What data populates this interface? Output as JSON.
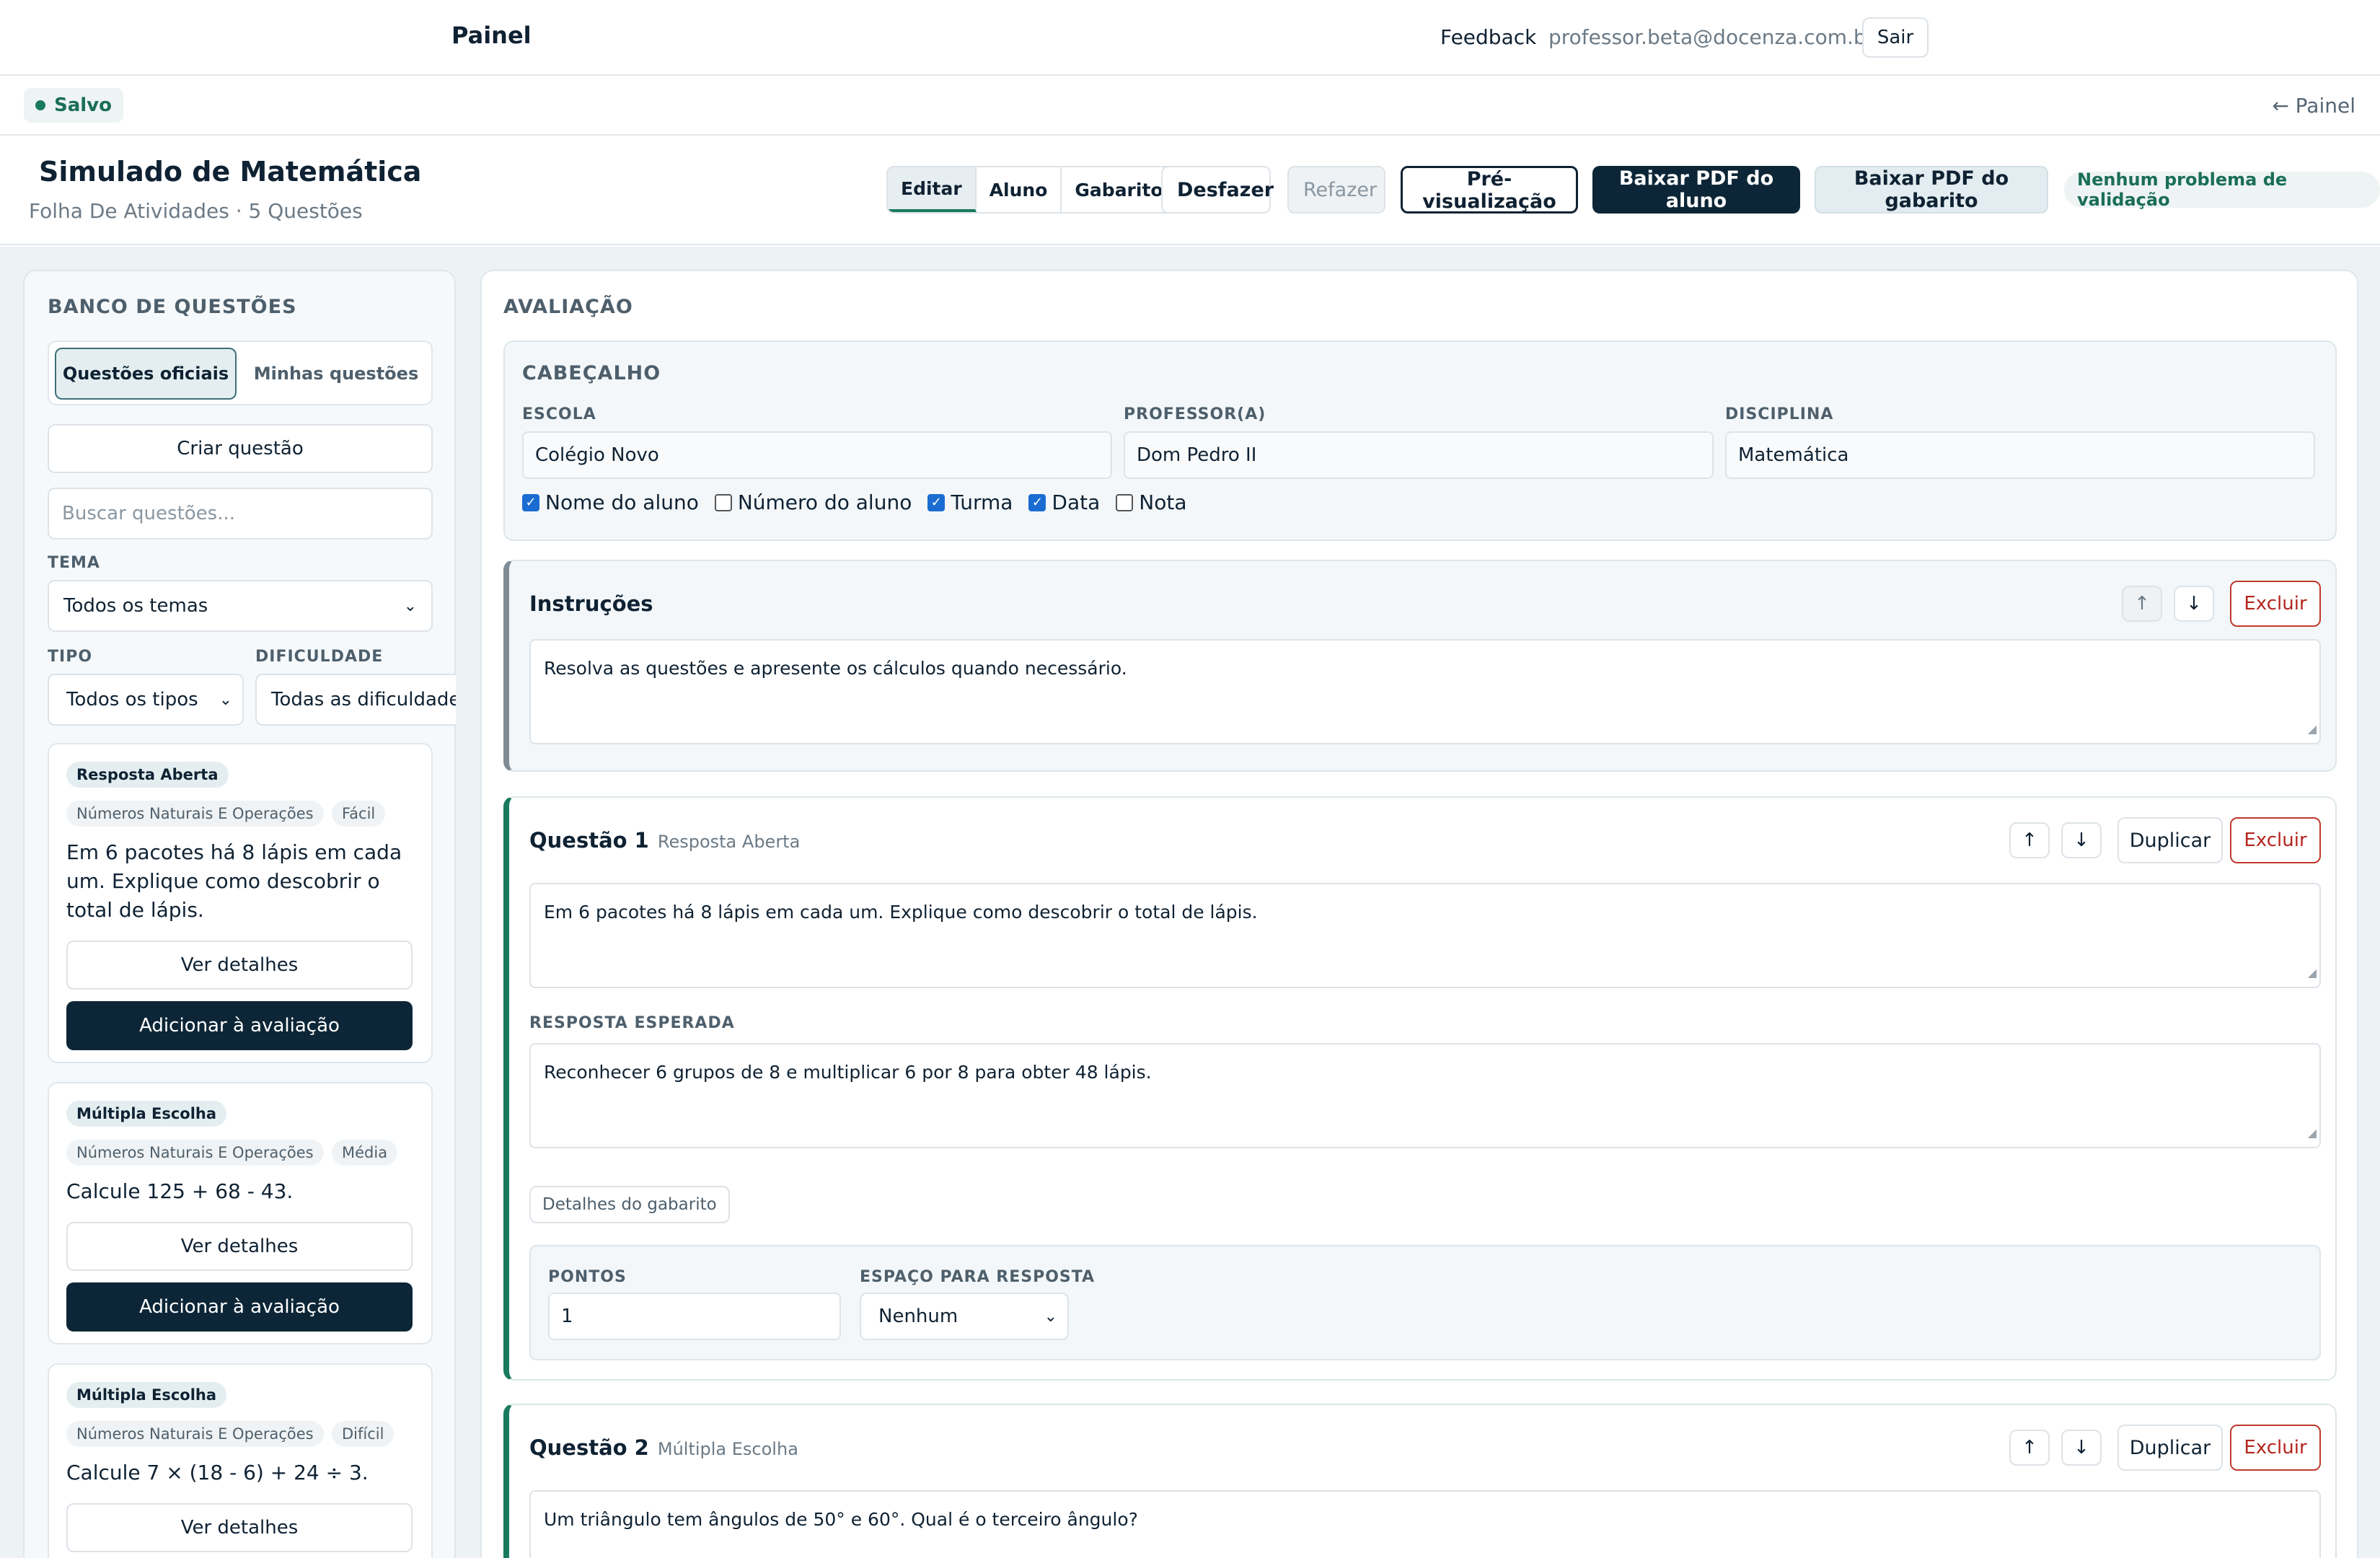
{
  "topnav": {
    "brand": "Painel",
    "feedback": "Feedback",
    "email": "professor.beta@docenza.com.br",
    "logout": "Sair"
  },
  "status": {
    "saved": "Salvo",
    "back": "← Painel"
  },
  "title": {
    "name": "Simulado de Matemática",
    "subtitle": "Folha De Atividades · 5 Questões",
    "modes": [
      "Editar",
      "Aluno",
      "Gabarito"
    ],
    "undo": "Desfazer",
    "redo": "Refazer",
    "preview": "Pré-visualização",
    "pdf_student": "Baixar PDF do aluno",
    "pdf_key": "Baixar PDF do gabarito",
    "validation": "Nenhum problema de validação"
  },
  "sidebar": {
    "heading": "BANCO DE QUESTÕES",
    "tabs": [
      "Questões oficiais",
      "Minhas questões"
    ],
    "create": "Criar questão",
    "search_placeholder": "Buscar questões...",
    "theme_label": "TEMA",
    "theme_value": "Todos os temas",
    "type_label": "TIPO",
    "type_value": "Todos os tipos",
    "difficulty_label": "DIFICULDADE",
    "difficulty_value": "Todas as dificuldades",
    "details_btn": "Ver detalhes",
    "add_btn": "Adicionar à avaliação",
    "cards": [
      {
        "type": "Resposta Aberta",
        "topic": "Números Naturais E Operações",
        "level": "Fácil",
        "text": "Em 6 pacotes há 8 lápis em cada um. Explique como descobrir o total de lápis."
      },
      {
        "type": "Múltipla Escolha",
        "topic": "Números Naturais E Operações",
        "level": "Média",
        "text": "Calcule 125 + 68 - 43."
      },
      {
        "type": "Múltipla Escolha",
        "topic": "Números Naturais E Operações",
        "level": "Difícil",
        "text": "Calcule 7 × (18 - 6) + 24 ÷ 3."
      }
    ]
  },
  "assessment": {
    "heading": "AVALIAÇÃO",
    "header": {
      "title": "CABEÇALHO",
      "school_label": "ESCOLA",
      "school": "Colégio Novo",
      "teacher_label": "PROFESSOR(A)",
      "teacher": "Dom Pedro II",
      "subject_label": "DISCIPLINA",
      "subject": "Matemática",
      "checks": [
        {
          "label": "Nome do aluno",
          "checked": true
        },
        {
          "label": "Número do aluno",
          "checked": false
        },
        {
          "label": "Turma",
          "checked": true
        },
        {
          "label": "Data",
          "checked": true
        },
        {
          "label": "Nota",
          "checked": false
        }
      ]
    },
    "instructions": {
      "title": "Instruções",
      "text": "Resolva as questões e apresente os cálculos quando necessário.",
      "delete": "Excluir"
    },
    "duplicate": "Duplicar",
    "delete": "Excluir",
    "q1": {
      "title": "Questão 1",
      "type": "Resposta Aberta",
      "text": "Em 6 pacotes há 8 lápis em cada um. Explique como descobrir o total de lápis.",
      "expected_label": "RESPOSTA ESPERADA",
      "expected": "Reconhecer 6 grupos de 8 e multiplicar 6 por 8 para obter 48 lápis.",
      "key_details": "Detalhes do gabarito",
      "points_label": "PONTOS",
      "points": "1",
      "space_label": "ESPAÇO PARA RESPOSTA",
      "space": "Nenhum"
    },
    "q2": {
      "title": "Questão 2",
      "type": "Múltipla Escolha",
      "text": "Um triângulo tem ângulos de 50° e 60°. Qual é o terceiro ângulo?"
    }
  },
  "icons": [
    "arrow-up-icon",
    "arrow-down-icon",
    "chevron-down-icon",
    "status-dot-icon"
  ],
  "colors": {
    "accent": "#1a7a5e",
    "dark": "#0d2637",
    "danger": "#b3261e"
  }
}
